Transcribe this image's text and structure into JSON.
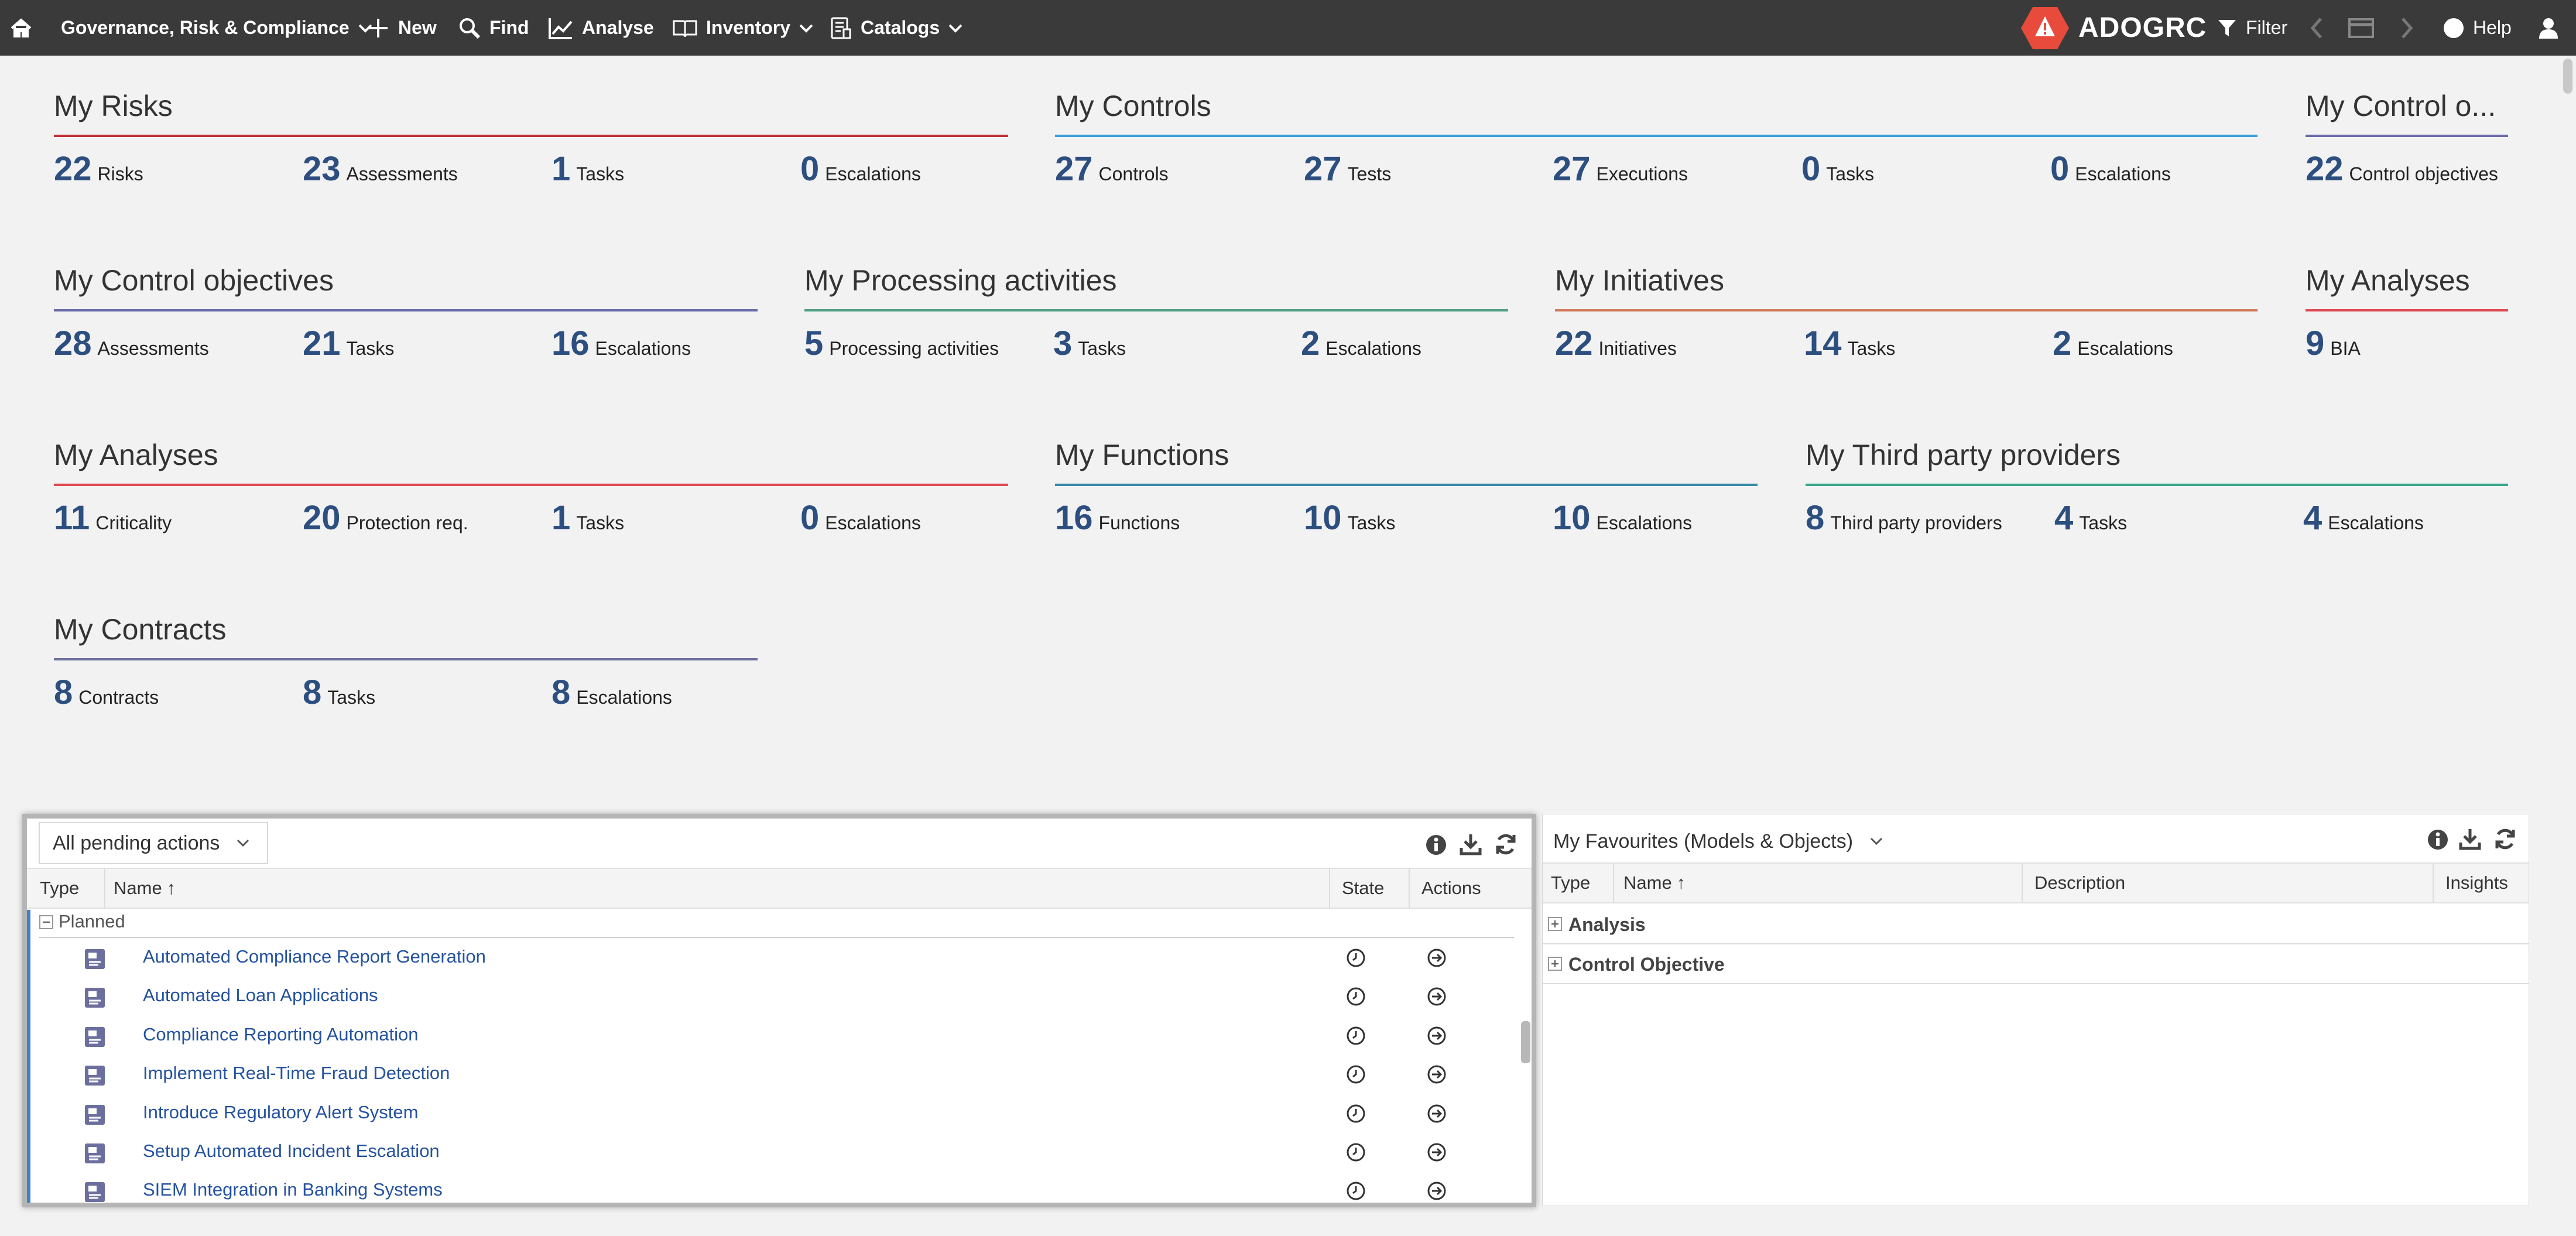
{
  "topbar": {
    "module": "Governance, Risk & Compliance",
    "new": "New",
    "find": "Find",
    "analyse": "Analyse",
    "inventory": "Inventory",
    "catalogs": "Catalogs",
    "brand": "ADOGRC",
    "filter": "Filter",
    "help": "Help"
  },
  "widgets": [
    {
      "title": "My Risks",
      "color": "#c0323a",
      "metrics": [
        {
          "n": "22",
          "l": "Risks"
        },
        {
          "n": "23",
          "l": "Assessments"
        },
        {
          "n": "1",
          "l": "Tasks"
        },
        {
          "n": "0",
          "l": "Escalations"
        }
      ]
    },
    {
      "title": "My Controls",
      "color": "#3aa0d8",
      "metrics": [
        {
          "n": "27",
          "l": "Controls"
        },
        {
          "n": "27",
          "l": "Tests"
        },
        {
          "n": "27",
          "l": "Executions"
        },
        {
          "n": "0",
          "l": "Tasks"
        },
        {
          "n": "0",
          "l": "Escalations"
        }
      ]
    },
    {
      "title": "My Control o...",
      "color": "#6b6aa8",
      "metrics": [
        {
          "n": "22",
          "l": "Control objectives"
        }
      ]
    },
    {
      "title": "My Control objectives",
      "color": "#6b6aa8",
      "metrics": [
        {
          "n": "28",
          "l": "Assessments"
        },
        {
          "n": "21",
          "l": "Tasks"
        },
        {
          "n": "16",
          "l": "Escalations"
        }
      ]
    },
    {
      "title": "My Processing activities",
      "color": "#4f9e86",
      "metrics": [
        {
          "n": "5",
          "l": "Processing activities"
        },
        {
          "n": "3",
          "l": "Tasks"
        },
        {
          "n": "2",
          "l": "Escalations"
        }
      ]
    },
    {
      "title": "My Initiatives",
      "color": "#d07a5a",
      "metrics": [
        {
          "n": "22",
          "l": "Initiatives"
        },
        {
          "n": "14",
          "l": "Tasks"
        },
        {
          "n": "2",
          "l": "Escalations"
        }
      ]
    },
    {
      "title": "My Analyses",
      "color": "#e04a55",
      "metrics": [
        {
          "n": "9",
          "l": "BIA"
        }
      ]
    },
    {
      "title": "My Analyses",
      "color": "#e04a55",
      "metrics": [
        {
          "n": "11",
          "l": "Criticality"
        },
        {
          "n": "20",
          "l": "Protection req."
        },
        {
          "n": "1",
          "l": "Tasks"
        },
        {
          "n": "0",
          "l": "Escalations"
        }
      ]
    },
    {
      "title": "My Functions",
      "color": "#3a8aaa",
      "metrics": [
        {
          "n": "16",
          "l": "Functions"
        },
        {
          "n": "10",
          "l": "Tasks"
        },
        {
          "n": "10",
          "l": "Escalations"
        }
      ]
    },
    {
      "title": "My Third party providers",
      "color": "#3aa68a",
      "metrics": [
        {
          "n": "8",
          "l": "Third party providers"
        },
        {
          "n": "4",
          "l": "Tasks"
        },
        {
          "n": "4",
          "l": "Escalations"
        }
      ]
    },
    {
      "title": "My Contracts",
      "color": "#6f6fa0",
      "metrics": [
        {
          "n": "8",
          "l": "Contracts"
        },
        {
          "n": "8",
          "l": "Tasks"
        },
        {
          "n": "8",
          "l": "Escalations"
        }
      ]
    }
  ],
  "pending": {
    "dropdown": "All pending actions",
    "columns": {
      "type": "Type",
      "name": "Name",
      "state": "State",
      "actions": "Actions"
    },
    "group": "Planned",
    "rows": [
      "Automated Compliance Report Generation",
      "Automated Loan Applications",
      "Compliance Reporting Automation",
      "Implement Real-Time Fraud Detection",
      "Introduce Regulatory Alert System",
      "Setup Automated Incident Escalation",
      "SIEM Integration in Banking Systems"
    ]
  },
  "favourites": {
    "title": "My Favourites (Models & Objects)",
    "columns": {
      "type": "Type",
      "name": "Name",
      "description": "Description",
      "insights": "Insights"
    },
    "groups": [
      "Analysis",
      "Control Objective"
    ]
  }
}
